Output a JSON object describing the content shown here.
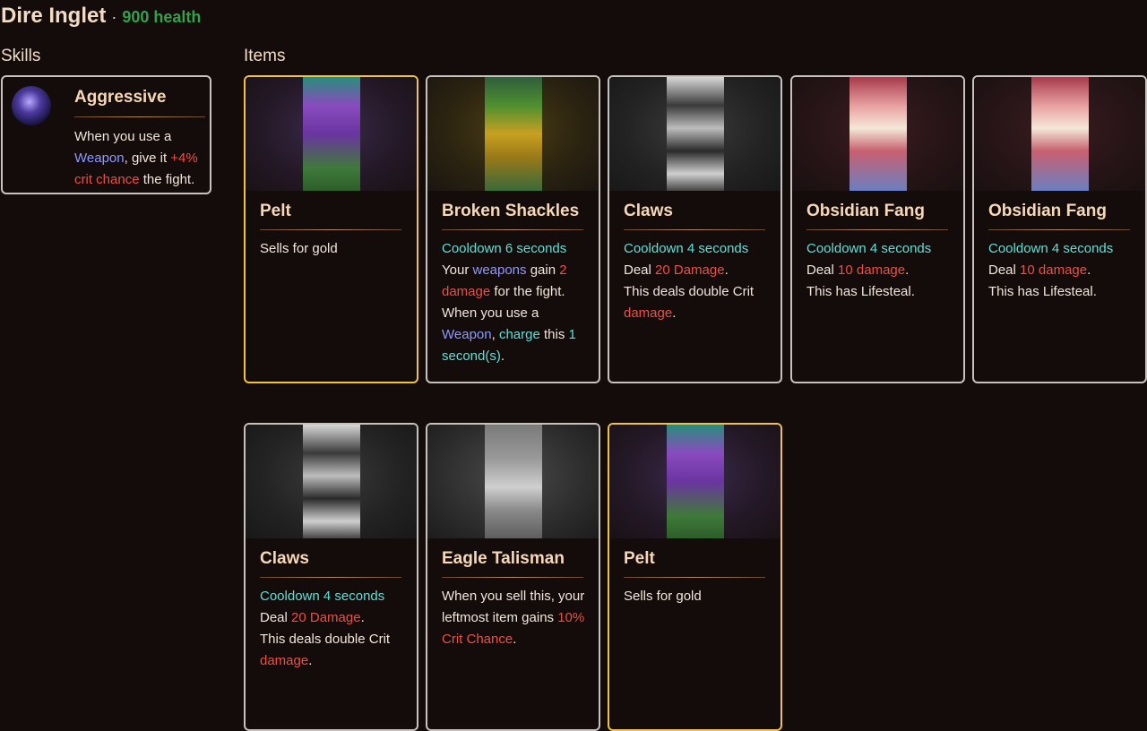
{
  "header": {
    "title": "Dire Inglet",
    "separator": "·",
    "health": "900 health"
  },
  "skills_label": "Skills",
  "items_label": "Items",
  "skill": {
    "name": "Aggressive",
    "icon": "wolf-portrait-icon",
    "desc": [
      {
        "t": "When you use a ",
        "c": ""
      },
      {
        "t": "Weapon",
        "c": "wpn"
      },
      {
        "t": ", give it ",
        "c": ""
      },
      {
        "t": "+4% crit chance",
        "c": "dmg"
      },
      {
        "t": " the fight.",
        "c": ""
      }
    ]
  },
  "cards": [
    {
      "name": "Pelt",
      "border": "gold",
      "art": "pelt",
      "desc": [
        {
          "t": "Sells for gold",
          "c": ""
        }
      ]
    },
    {
      "name": "Broken Shackles",
      "border": "silver",
      "art": "shackles",
      "desc": [
        {
          "t": "Cooldown 6 seconds",
          "c": "cd"
        },
        {
          "br": true
        },
        {
          "t": "Your ",
          "c": ""
        },
        {
          "t": "weapons",
          "c": "wpn"
        },
        {
          "t": " gain ",
          "c": ""
        },
        {
          "t": "2 damage",
          "c": "dmg"
        },
        {
          "t": " for the fight.",
          "c": ""
        },
        {
          "br": true
        },
        {
          "t": "When you use a ",
          "c": ""
        },
        {
          "t": "Weapon",
          "c": "wpn"
        },
        {
          "t": ", ",
          "c": ""
        },
        {
          "t": "charge",
          "c": "chg"
        },
        {
          "t": " this ",
          "c": ""
        },
        {
          "t": "1 second(s)",
          "c": "chg"
        },
        {
          "t": ".",
          "c": ""
        }
      ]
    },
    {
      "name": "Claws",
      "border": "silver",
      "art": "claws",
      "desc": [
        {
          "t": "Cooldown 4 seconds",
          "c": "cd"
        },
        {
          "br": true
        },
        {
          "t": "Deal ",
          "c": ""
        },
        {
          "t": "20 Damage",
          "c": "dmg"
        },
        {
          "t": ".",
          "c": ""
        },
        {
          "br": true
        },
        {
          "t": "This deals double Crit ",
          "c": ""
        },
        {
          "t": "damage",
          "c": "dmg"
        },
        {
          "t": ".",
          "c": ""
        }
      ]
    },
    {
      "name": "Obsidian Fang",
      "border": "silver",
      "art": "fang",
      "desc": [
        {
          "t": "Cooldown 4 seconds",
          "c": "cd"
        },
        {
          "br": true
        },
        {
          "t": "Deal ",
          "c": ""
        },
        {
          "t": "10 damage",
          "c": "dmg"
        },
        {
          "t": ".",
          "c": ""
        },
        {
          "br": true
        },
        {
          "t": "This has Lifesteal.",
          "c": ""
        }
      ]
    },
    {
      "name": "Obsidian Fang",
      "border": "silver",
      "art": "fang",
      "desc": [
        {
          "t": "Cooldown 4 seconds",
          "c": "cd"
        },
        {
          "br": true
        },
        {
          "t": "Deal ",
          "c": ""
        },
        {
          "t": "10 damage",
          "c": "dmg"
        },
        {
          "t": ".",
          "c": ""
        },
        {
          "br": true
        },
        {
          "t": "This has Lifesteal.",
          "c": ""
        }
      ]
    },
    {
      "name": "Claws",
      "border": "silver",
      "art": "claws",
      "desc": [
        {
          "t": "Cooldown 4 seconds",
          "c": "cd"
        },
        {
          "br": true
        },
        {
          "t": "Deal ",
          "c": ""
        },
        {
          "t": "20 Damage",
          "c": "dmg"
        },
        {
          "t": ".",
          "c": ""
        },
        {
          "br": true
        },
        {
          "t": "This deals double Crit ",
          "c": ""
        },
        {
          "t": "damage",
          "c": "dmg"
        },
        {
          "t": ".",
          "c": ""
        }
      ]
    },
    {
      "name": "Eagle Talisman",
      "border": "silver",
      "art": "talisman",
      "desc": [
        {
          "t": "When you sell this, your leftmost item gains ",
          "c": ""
        },
        {
          "t": "10% Crit Chance",
          "c": "dmg"
        },
        {
          "t": ".",
          "c": ""
        }
      ]
    },
    {
      "name": "Pelt",
      "border": "gold",
      "art": "pelt",
      "desc": [
        {
          "t": "Sells for gold",
          "c": ""
        }
      ]
    }
  ],
  "colors": {
    "background": "#140c0b",
    "gold_border": "#f0c246",
    "silver_border": "#c8c2be",
    "health": "#2fa24a",
    "cooldown": "#5fe0d6",
    "damage": "#ee4f45",
    "weapon": "#8d99ff"
  }
}
